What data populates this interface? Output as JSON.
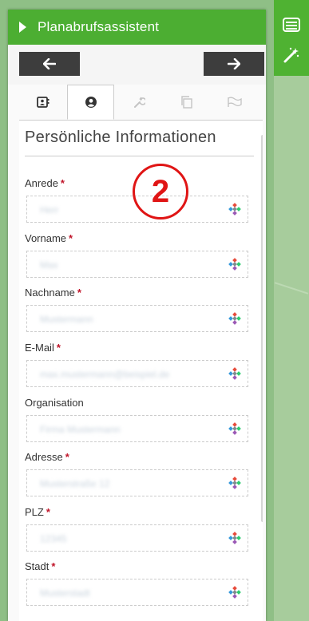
{
  "header": {
    "title": "Planabrufsassistent"
  },
  "section": {
    "title": "Persönliche Informationen"
  },
  "badge": {
    "number": "2"
  },
  "fields": [
    {
      "label": "Anrede",
      "required": "*",
      "value": "Herr"
    },
    {
      "label": "Vorname",
      "required": "*",
      "value": "Max"
    },
    {
      "label": "Nachname",
      "required": "*",
      "value": "Mustermann"
    },
    {
      "label": "E-Mail",
      "required": "*",
      "value": "max.mustermann@beispiel.de"
    },
    {
      "label": "Organisation",
      "required": "",
      "value": "Firma Mustermann"
    },
    {
      "label": "Adresse",
      "required": "*",
      "value": "Musterstraße 12"
    },
    {
      "label": "PLZ",
      "required": "*",
      "value": "12345"
    },
    {
      "label": "Stadt",
      "required": "*",
      "value": "Musterstadt"
    }
  ],
  "tabs": [
    {
      "name": "contact-card-icon",
      "state": "enabled"
    },
    {
      "name": "person-icon",
      "state": "active"
    },
    {
      "name": "wrench-icon",
      "state": "disabled"
    },
    {
      "name": "copy-icon",
      "state": "disabled"
    },
    {
      "name": "flag-icon",
      "state": "disabled"
    }
  ],
  "colors": {
    "header": "#4cae32",
    "required": "#c0152a",
    "badge": "#e01515"
  }
}
